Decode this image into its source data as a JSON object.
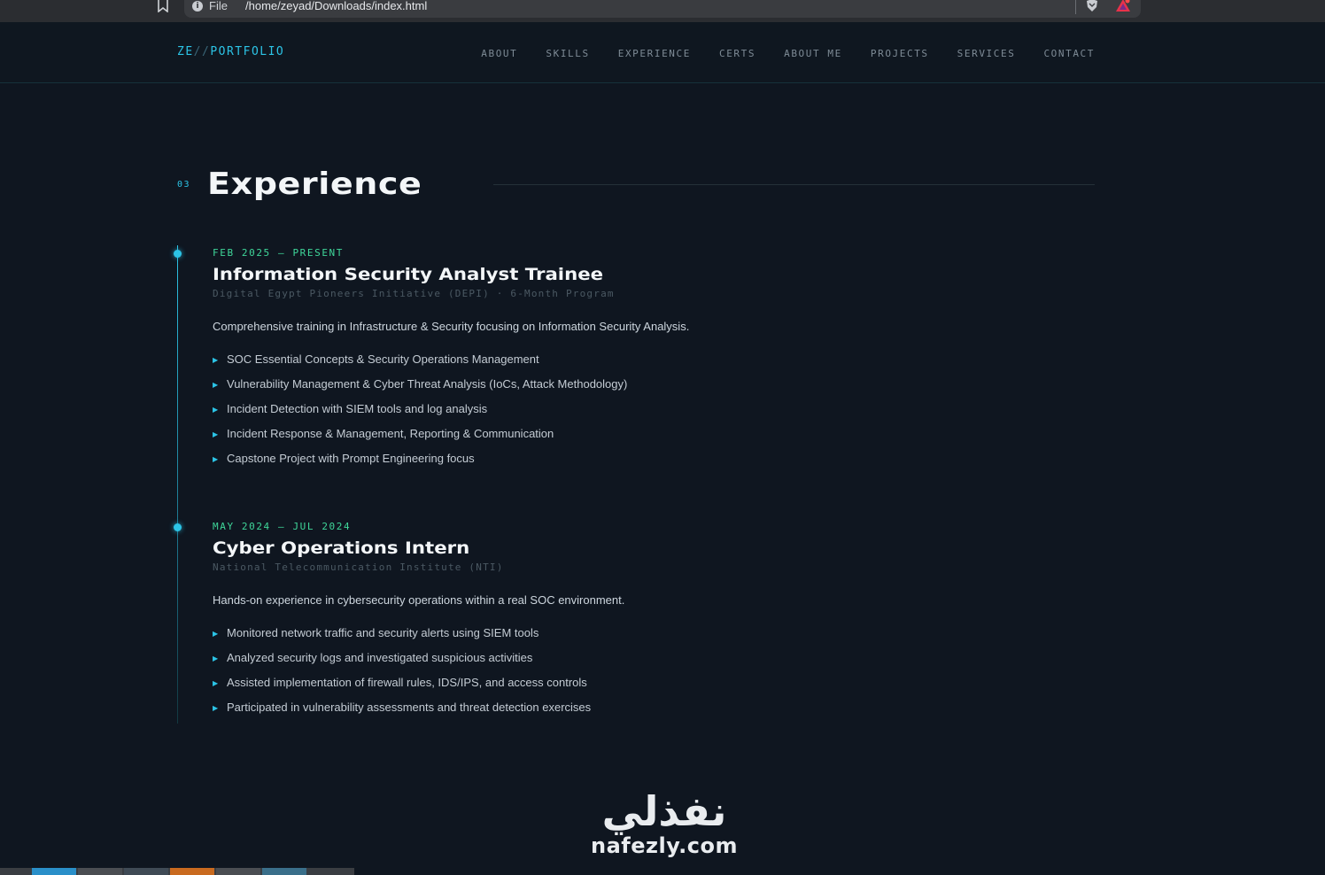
{
  "browser": {
    "url_scheme": "File",
    "url_path": "/home/zeyad/Downloads/index.html"
  },
  "logo": {
    "prefix": "ZE",
    "slash": "//",
    "suffix": "PORTFOLIO"
  },
  "nav": [
    "ABOUT",
    "SKILLS",
    "EXPERIENCE",
    "CERTS",
    "ABOUT ME",
    "PROJECTS",
    "SERVICES",
    "CONTACT"
  ],
  "section": {
    "number": "03",
    "title": "Experience"
  },
  "jobs": [
    {
      "date": "FEB 2025 — PRESENT",
      "title": "Information Security Analyst Trainee",
      "org": "Digital Egypt Pioneers Initiative (DEPI) · 6-Month Program",
      "description": "Comprehensive training in Infrastructure & Security focusing on Information Security Analysis.",
      "bullets": [
        "SOC Essential Concepts & Security Operations Management",
        "Vulnerability Management & Cyber Threat Analysis (IoCs, Attack Methodology)",
        "Incident Detection with SIEM tools and log analysis",
        "Incident Response & Management, Reporting & Communication",
        "Capstone Project with Prompt Engineering focus"
      ]
    },
    {
      "date": "MAY 2024 — JUL 2024",
      "title": "Cyber Operations Intern",
      "org": "National Telecommunication Institute (NTI)",
      "description": "Hands-on experience in cybersecurity operations within a real SOC environment.",
      "bullets": [
        "Monitored network traffic and security alerts using SIEM tools",
        "Analyzed security logs and investigated suspicious activities",
        "Assisted implementation of firewall rules, IDS/IPS, and access controls",
        "Participated in vulnerability assessments and threat detection exercises"
      ]
    }
  ],
  "bullet_glyph": "▶",
  "watermark": {
    "arabic": "نفذلي",
    "latin": "nafezly.com"
  },
  "colors": {
    "accent": "#2cc4e6",
    "date": "#3fd79a",
    "background": "#0f1620"
  }
}
